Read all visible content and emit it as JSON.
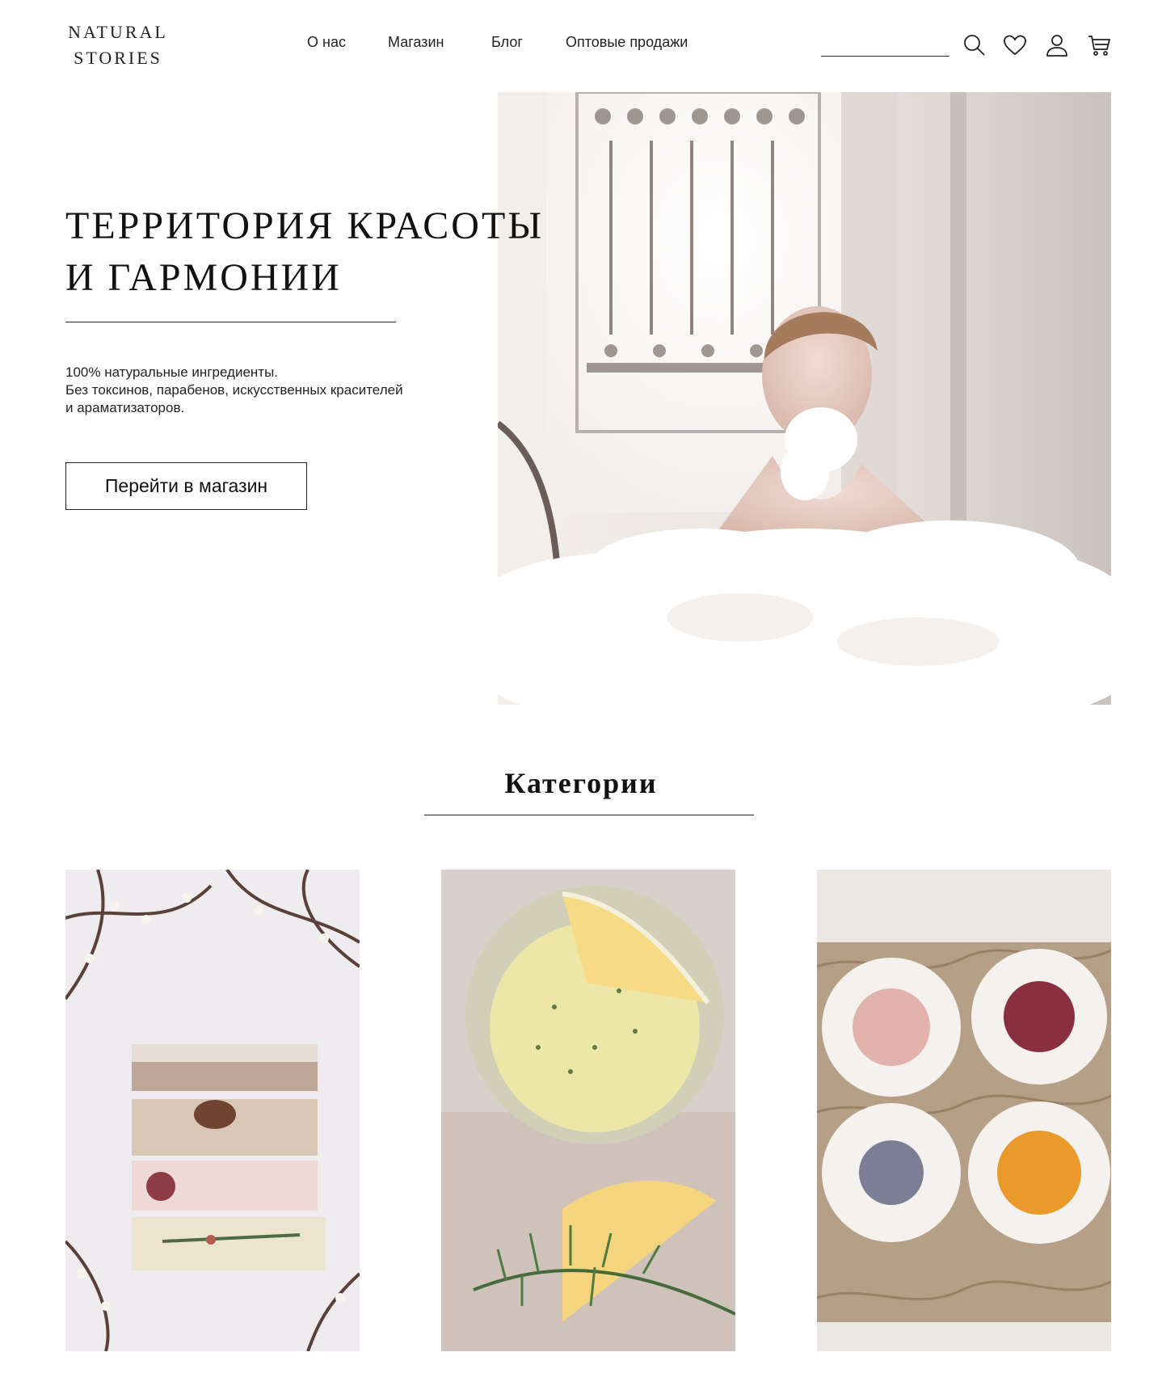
{
  "header": {
    "logo_line1": "NATURAL",
    "logo_line2": "STORIES",
    "nav": [
      {
        "label": "О нас"
      },
      {
        "label": "Магазин"
      },
      {
        "label": "Блог"
      },
      {
        "label": "Оптовые продажи"
      }
    ],
    "search_value": "",
    "icons": [
      "search-icon",
      "heart-icon",
      "user-icon",
      "cart-icon"
    ]
  },
  "hero": {
    "title_line1": "ТЕРРИТОРИЯ КРАСОТЫ",
    "title_line2": "И ГАРМОНИИ",
    "desc_line1": "100% натуральные ингредиенты.",
    "desc_line2": "Без токсинов, парабенов, искусственных красителей",
    "desc_line3": "и араматизаторов.",
    "cta_label": "Перейти в магазин"
  },
  "categories": {
    "title": "Категории"
  },
  "colors": {
    "text": "#111111",
    "background": "#ffffff",
    "rule": "#222222"
  }
}
